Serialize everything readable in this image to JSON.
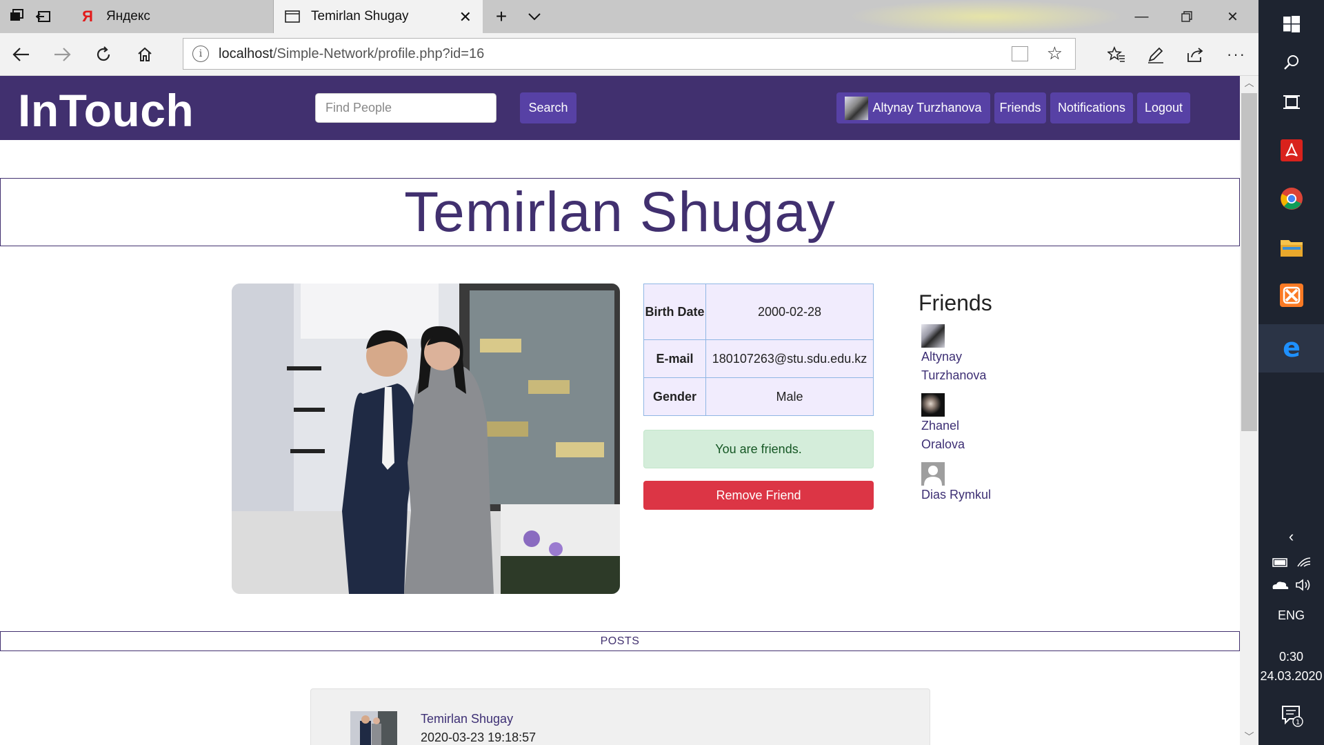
{
  "browser": {
    "tabs": [
      {
        "title": "Яндекс",
        "active": false
      },
      {
        "title": "Temirlan Shugay",
        "active": true
      }
    ],
    "url_host": "localhost",
    "url_path": "/Simple-Network/profile.php?id=16"
  },
  "header": {
    "brand": "InTouch",
    "search_placeholder": "Find People",
    "search_button": "Search",
    "user_name": "Altynay Turzhanova",
    "friends_link": "Friends",
    "notifications_link": "Notifications",
    "logout_link": "Logout"
  },
  "profile": {
    "name": "Temirlan Shugay",
    "info": [
      {
        "label": "Birth Date",
        "value": "2000-02-28"
      },
      {
        "label": "E-mail",
        "value": "180107263@stu.sdu.edu.kz"
      },
      {
        "label": "Gender",
        "value": "Male"
      }
    ],
    "friend_status": "You are friends.",
    "remove_button": "Remove Friend"
  },
  "friends": {
    "title": "Friends",
    "items": [
      {
        "name": "Altynay Turzhanova"
      },
      {
        "name": "Zhanel Oralova"
      },
      {
        "name": "Dias Rymkul"
      }
    ]
  },
  "posts": {
    "title": "POSTS",
    "items": [
      {
        "author": "Temirlan Shugay",
        "date": "2020-03-23 19:18:57"
      }
    ]
  },
  "taskbar": {
    "language": "ENG",
    "time": "0:30",
    "date": "24.03.2020",
    "notifications_count": "1"
  },
  "colors": {
    "brand": "#41306f",
    "button": "#5741a5",
    "danger": "#dc3545",
    "success_bg": "#d4edda"
  }
}
